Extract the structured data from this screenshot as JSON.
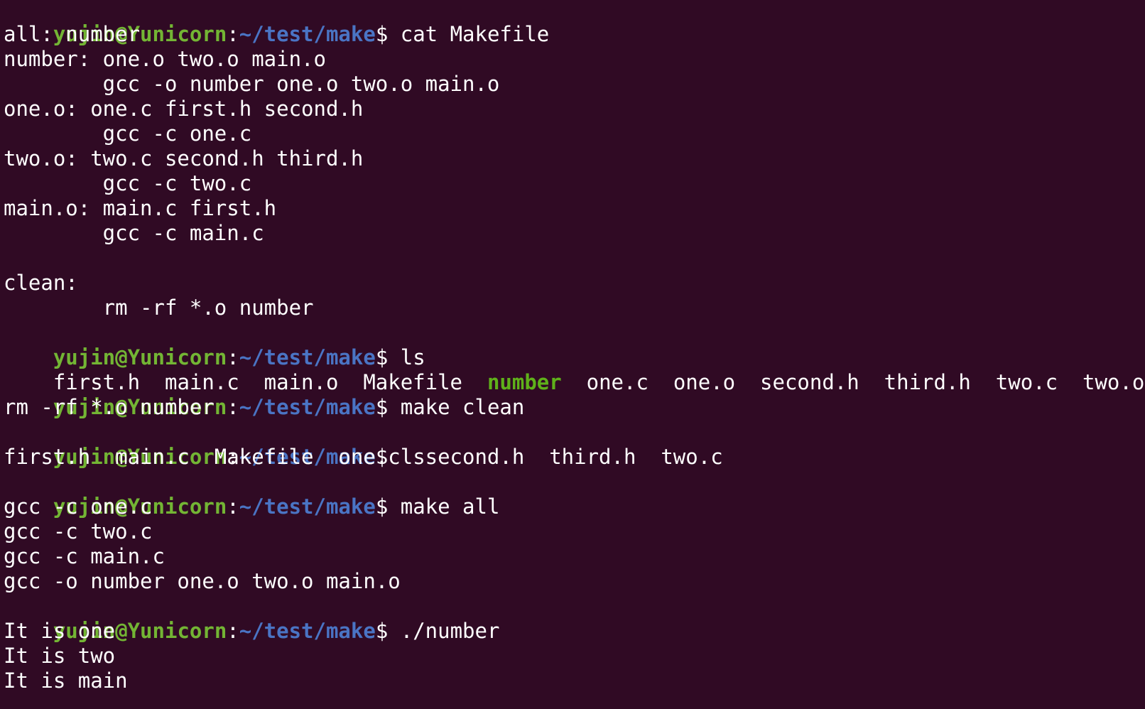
{
  "colors": {
    "background": "#300a24",
    "text": "#ffffff",
    "prompt_user": "#73b534",
    "prompt_path": "#4a74c4",
    "executable": "#5fb11a"
  },
  "prompt": {
    "user_host": "yujin@Yunicorn",
    "colon": ":",
    "path": "~/test/make",
    "dollar": "$"
  },
  "lines": [
    {
      "type": "prompt",
      "command": " cat Makefile"
    },
    {
      "type": "text",
      "text": "all: number"
    },
    {
      "type": "text",
      "text": "number: one.o two.o main.o"
    },
    {
      "type": "text",
      "text": "        gcc -o number one.o two.o main.o"
    },
    {
      "type": "text",
      "text": "one.o: one.c first.h second.h"
    },
    {
      "type": "text",
      "text": "        gcc -c one.c"
    },
    {
      "type": "text",
      "text": "two.o: two.c second.h third.h"
    },
    {
      "type": "text",
      "text": "        gcc -c two.c"
    },
    {
      "type": "text",
      "text": "main.o: main.c first.h"
    },
    {
      "type": "text",
      "text": "        gcc -c main.c"
    },
    {
      "type": "text",
      "text": ""
    },
    {
      "type": "text",
      "text": "clean:"
    },
    {
      "type": "text",
      "text": "        rm -rf *.o number"
    },
    {
      "type": "prompt",
      "command": " ls"
    },
    {
      "type": "ls",
      "before": "first.h  main.c  main.o  Makefile  ",
      "exec": "number",
      "after": "  one.c  one.o  second.h  third.h  two.c  two.o"
    },
    {
      "type": "prompt",
      "command": " make clean"
    },
    {
      "type": "text",
      "text": "rm -rf *.o number"
    },
    {
      "type": "prompt",
      "command": " ls"
    },
    {
      "type": "text",
      "text": "first.h  main.c  Makefile  one.c  second.h  third.h  two.c"
    },
    {
      "type": "prompt",
      "command": " make all"
    },
    {
      "type": "text",
      "text": "gcc -c one.c"
    },
    {
      "type": "text",
      "text": "gcc -c two.c"
    },
    {
      "type": "text",
      "text": "gcc -c main.c"
    },
    {
      "type": "text",
      "text": "gcc -o number one.o two.o main.o"
    },
    {
      "type": "prompt",
      "command": " ./number"
    },
    {
      "type": "text",
      "text": "It is one"
    },
    {
      "type": "text",
      "text": "It is two"
    },
    {
      "type": "text",
      "text": "It is main"
    }
  ]
}
